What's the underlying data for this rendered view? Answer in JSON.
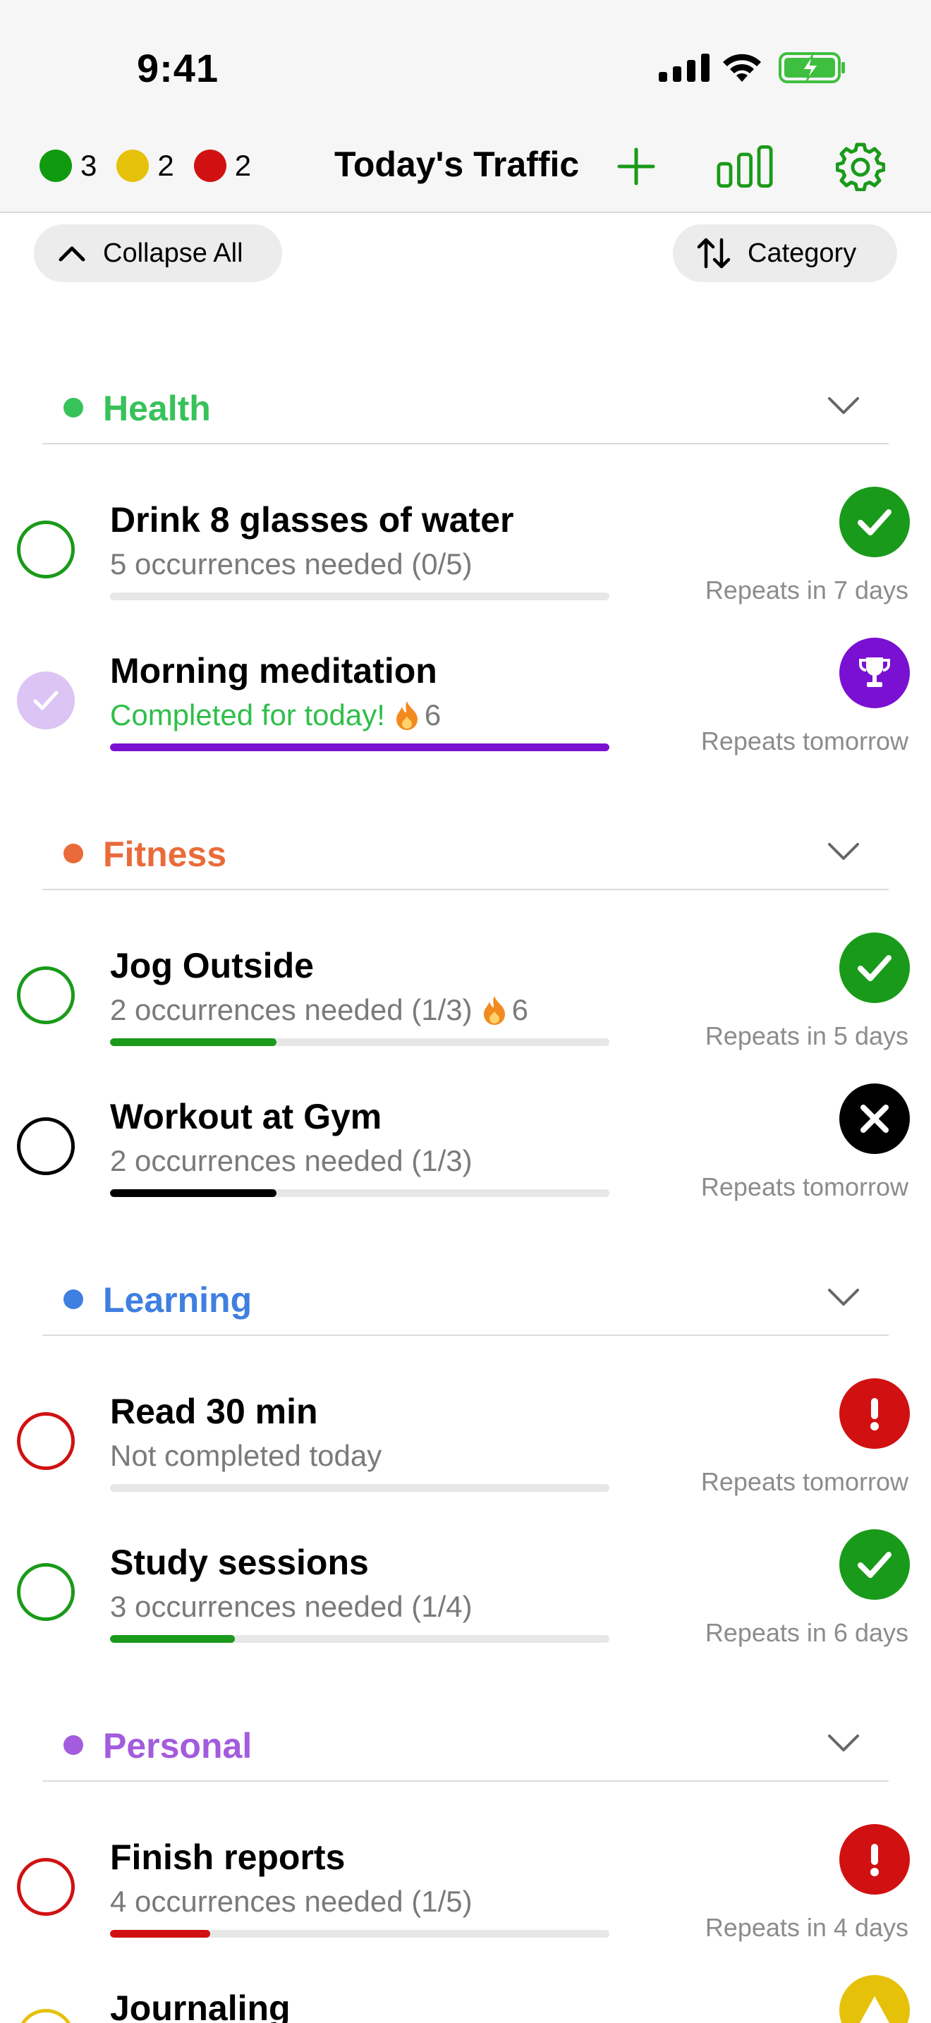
{
  "status_bar": {
    "time": "9:41"
  },
  "header": {
    "title": "Today's Traffic",
    "counts": [
      {
        "color": "#0f9a0f",
        "value": "3"
      },
      {
        "color": "#e6c10a",
        "value": "2"
      },
      {
        "color": "#d11111",
        "value": "2"
      }
    ]
  },
  "controls": {
    "collapse_label": "Collapse All",
    "sort_label": "Category"
  },
  "colors": {
    "accent_green": "#1a9a1a",
    "purple": "#7a10d1",
    "red": "#d11111",
    "gray_track": "#e7e7e7"
  },
  "sections": [
    {
      "name": "Health",
      "color": "#37c25a",
      "items": [
        {
          "title": "Drink 8 glasses of water",
          "subtitle": "5 occurrences needed (0/5)",
          "repeat": "Repeats in 7 days",
          "status": "check",
          "progress": 0
        },
        {
          "title": "Morning meditation",
          "subtitle": "Completed for today!",
          "streak": "6",
          "repeat": "Repeats tomorrow",
          "status": "trophy",
          "progress": 1.0
        }
      ]
    },
    {
      "name": "Fitness",
      "color": "#ea6b3a",
      "items": [
        {
          "title": "Jog Outside",
          "subtitle": "2 occurrences needed (1/3)",
          "streak": "6",
          "repeat": "Repeats in 5 days",
          "status": "check",
          "progress": 0.333
        },
        {
          "title": "Workout at Gym",
          "subtitle": "2 occurrences needed (1/3)",
          "repeat": "Repeats tomorrow",
          "status": "x",
          "progress": 0.333
        }
      ]
    },
    {
      "name": "Learning",
      "color": "#3f7fe0",
      "items": [
        {
          "title": "Read 30 min",
          "subtitle": "Not completed today",
          "repeat": "Repeats tomorrow",
          "status": "alert",
          "progress": 0
        },
        {
          "title": "Study sessions",
          "subtitle": "3 occurrences needed (1/4)",
          "repeat": "Repeats in 6 days",
          "status": "check",
          "progress": 0.25
        }
      ]
    },
    {
      "name": "Personal",
      "color": "#a35cdd",
      "items": [
        {
          "title": "Finish reports",
          "subtitle": "4 occurrences needed (1/5)",
          "repeat": "Repeats in 4 days",
          "status": "alert",
          "progress": 0.2
        },
        {
          "title": "Journaling",
          "status": "warning"
        }
      ]
    }
  ]
}
